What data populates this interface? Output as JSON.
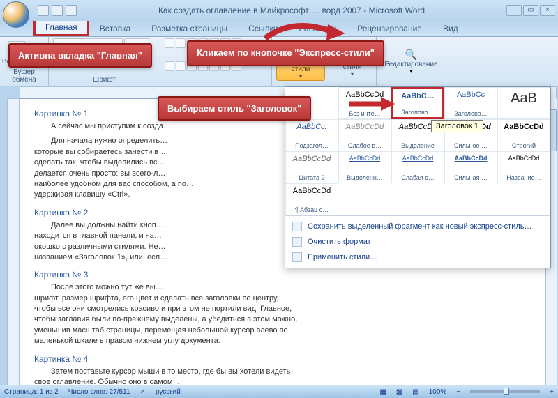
{
  "title": "Как создать оглавление в Майкрософт … ворд 2007 - Microsoft Word",
  "tabs": [
    "Главная",
    "Вставка",
    "Разметка страницы",
    "Ссылки",
    "Рассылки",
    "Рецензирование",
    "Вид"
  ],
  "ribbon_groups": {
    "clipboard": {
      "label": "Буфер обмена",
      "paste": "Вставить"
    },
    "font": {
      "label": "Шрифт"
    },
    "express": {
      "label": "Экспресс-стили",
      "change": "Изменить стили",
      "editing": "Редактирование"
    }
  },
  "callouts": {
    "active_tab": "Активна вкладка \"Главная\"",
    "click_express": "Кликаем по кнопочке \"Экспресс-стили\"",
    "choose_heading": "Выбираем стиль \"Заголовок\""
  },
  "styles_gallery": {
    "row1": [
      {
        "preview": "AaBbCcDd",
        "label": "Без инте…",
        "cls": ""
      },
      {
        "preview": "AaBbC…",
        "label": "Заголово…",
        "cls": "red-bordered"
      },
      {
        "preview": "AaBbCc",
        "label": "Заголово…",
        "cls": ""
      },
      {
        "preview": "AaB",
        "label": "",
        "cls": "big"
      }
    ],
    "row2": [
      {
        "preview": "AaBbCc.",
        "label": "Подзагол…",
        "color": "#2a5a9e"
      },
      {
        "preview": "AaBbCcDd",
        "label": "Слабое в…",
        "color": "#888",
        "italic": true
      },
      {
        "preview": "AaBbCcDd",
        "label": "Выделение",
        "color": "#333",
        "italic": true
      },
      {
        "preview": "AaBbCcDd",
        "label": "Сильное …",
        "color": "#333",
        "italic": true,
        "bold": true
      },
      {
        "preview": "AaBbCcDd",
        "label": "Строгий",
        "color": "#333",
        "bold": true
      }
    ],
    "row3": [
      {
        "preview": "AaBbCcDd",
        "label": "Цитата 2",
        "color": "#666",
        "italic": true
      },
      {
        "preview": "AaBbCcDd",
        "label": "Выделенн…",
        "color": "#2a5a9e",
        "underline": true,
        "small": true
      },
      {
        "preview": "AaBbCcDd",
        "label": "Слабая с…",
        "color": "#2a5a9e",
        "underline": true,
        "small": true
      },
      {
        "preview": "AaBbCcDd",
        "label": "Сильная …",
        "color": "#2a5a9e",
        "underline": true,
        "small": true,
        "bold": true
      },
      {
        "preview": "AaBbCcDd",
        "label": "Название…",
        "color": "#333",
        "small": true
      }
    ],
    "row4": [
      {
        "preview": "AaBbCcDd",
        "label": "¶ Абзац с…",
        "color": "#333"
      }
    ],
    "menu": [
      "Сохранить выделенный фрагмент как новый экспресс-стиль…",
      "Очистить формат",
      "Применить стили…"
    ]
  },
  "tooltip": "Заголовок 1",
  "document": {
    "h1": "Картинка № 1",
    "p1a": "А сейчас мы приступим к созда…",
    "p1b": "Для начала нужно определить…",
    "p1c": "которые вы собираетесь занести в …",
    "p1d": "сделать так, чтобы выделились вс…",
    "p1e": "делается очень просто: вы всего-л…",
    "p1f": "наиболее удобном для вас способом, а по…",
    "p1g": "удерживая клавишу «Ctrl».",
    "h2": "Картинка № 2",
    "p2a": "Далее вы должны найти кноп…",
    "p2b": "находится в главной панели, и на…",
    "p2c": "окошко с различными стилями. Не…",
    "p2d": "названием «Заголовок 1», или, есл…",
    "h3": "Картинка № 3",
    "p3a": "После этого можно тут же вы…",
    "p3b": "шрифт, размер шрифта, его цвет и сделать все заголовки по центру,",
    "p3c": "чтобы все они смотрелись красиво и при этом не портили вид. Главное,",
    "p3d": "чтобы заглавия были по-прежнему выделены, а убедиться в этом можно,",
    "p3e": "уменьшив масштаб страницы, перемещая небольшой курсор влево по",
    "p3f": "маленькой шкале в правом нижнем углу документа.",
    "h4": "Картинка № 4",
    "p4a": "Затем поставьте курсор мыши в то место, где бы вы хотели видеть",
    "p4b": "свое оглавление. Обычно оно в самом …"
  },
  "statusbar": {
    "page": "Страница: 1 из 2",
    "words": "Число слов: 27/511",
    "lang": "русский",
    "zoom": "100%"
  }
}
